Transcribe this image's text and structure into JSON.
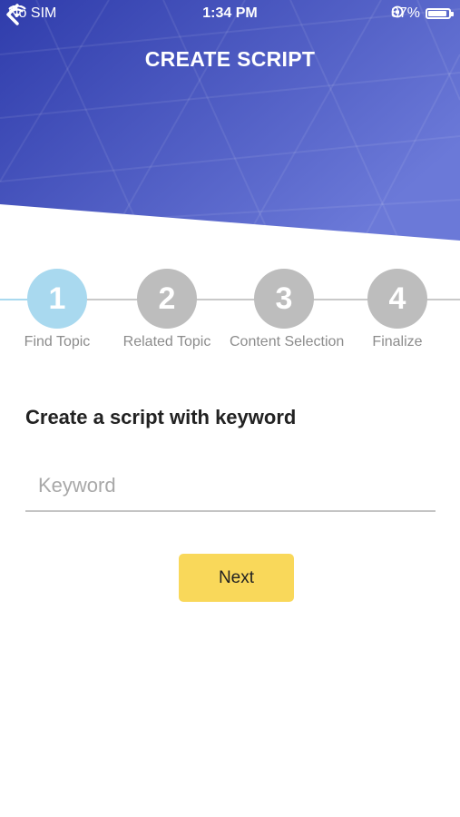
{
  "status_bar": {
    "carrier": "No SIM",
    "time": "1:34 PM",
    "battery": "87%"
  },
  "header": {
    "title": "CREATE SCRIPT",
    "gradient_start": "#3341b0",
    "gradient_end": "#6b79d8"
  },
  "stepper": {
    "steps": [
      {
        "number": "1",
        "label": "Find Topic",
        "active": true
      },
      {
        "number": "2",
        "label": "Related Topic",
        "active": false
      },
      {
        "number": "3",
        "label": "Content Selection",
        "active": false
      },
      {
        "number": "4",
        "label": "Finalize",
        "active": false
      }
    ]
  },
  "form": {
    "title": "Create a script with keyword",
    "keyword_value": "",
    "keyword_placeholder": "Keyword",
    "next_label": "Next"
  },
  "colors": {
    "active_step": "#a9d9ef",
    "inactive_step": "#bdbdbd",
    "next_button": "#f9d85a"
  }
}
